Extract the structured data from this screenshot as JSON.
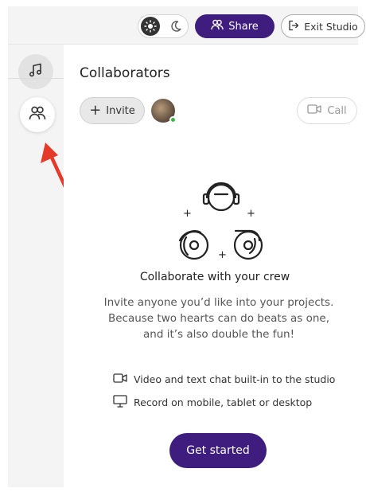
{
  "topbar": {
    "theme_toggle": {
      "active": "light"
    },
    "share_label": "Share",
    "exit_label": "Exit Studio"
  },
  "sidebar": {
    "items": [
      {
        "id": "music",
        "icon": "music-note-icon"
      },
      {
        "id": "collaborators",
        "icon": "people-icon",
        "active": true
      }
    ]
  },
  "panel": {
    "title": "Collaborators",
    "invite_label": "Invite",
    "call_label": "Call",
    "heading": "Collaborate with your crew",
    "description_lines": [
      "Invite anyone you’d like into your projects.",
      "Because two hearts can do beats as one,",
      "and it’s also double the fun!"
    ],
    "features": [
      {
        "icon": "video-camera-icon",
        "text": "Video and text chat built-in to the studio"
      },
      {
        "icon": "monitor-icon",
        "text": "Record on mobile, tablet or desktop"
      }
    ],
    "cta_label": "Get started"
  },
  "colors": {
    "accent": "#3f1d7f",
    "sidebar_bg": "#f4f4f4",
    "arrow": "#e53a2a",
    "online": "#3bb54a"
  }
}
